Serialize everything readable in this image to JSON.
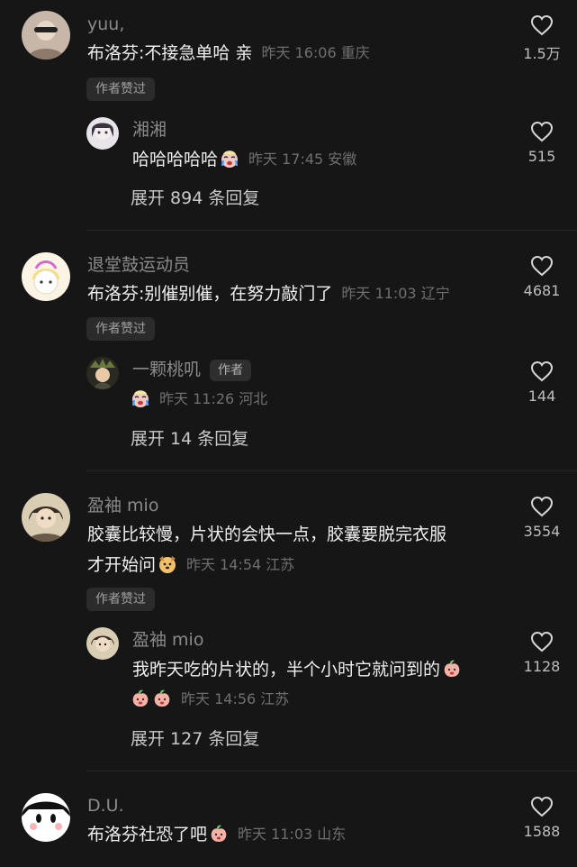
{
  "comments": [
    {
      "username": "yuu,",
      "text": "布洛芬:不接急单哈 亲",
      "meta": "昨天 16:06 重庆",
      "likes": "1.5万",
      "badge": "作者赞过",
      "reply": {
        "username": "湘湘",
        "text": "哈哈哈哈哈",
        "meta": "昨天 17:45 安徽",
        "likes": "515"
      },
      "expand_label": "展开 894 条回复"
    },
    {
      "username": "退堂鼓运动员",
      "text": "布洛芬:别催别催，在努力敲门了",
      "meta": "昨天 11:03 辽宁",
      "likes": "4681",
      "badge": "作者赞过",
      "reply": {
        "username": "一颗桃叽",
        "author_tag": "作者",
        "meta": "昨天 11:26 河北",
        "likes": "144"
      },
      "expand_label": "展开 14 条回复"
    },
    {
      "username": "盈袖 mio",
      "text_line1": "胶囊比较慢，片状的会快一点，胶囊要脱完衣服",
      "text_line2": "才开始问",
      "meta": "昨天 14:54 江苏",
      "likes": "3554",
      "badge": "作者赞过",
      "reply": {
        "username": "盈袖 mio",
        "text": "我昨天吃的片状的，半个小时它就问到的",
        "meta": "昨天 14:56 江苏",
        "likes": "1128"
      },
      "expand_label": "展开 127 条回复"
    },
    {
      "username": "D.U.",
      "text": "布洛芬社恐了吧",
      "meta": "昨天 11:03 山东",
      "likes": "1588"
    }
  ],
  "icons": {
    "like": "heart-outline-icon",
    "emoji_cry": "crying-face-emoji",
    "emoji_dog": "dog-face-emoji",
    "emoji_peach": "peach-face-emoji"
  },
  "colors": {
    "background": "#161616",
    "username": "#8a8a8a",
    "text": "#eeeeee",
    "meta": "#6f6f6f"
  }
}
